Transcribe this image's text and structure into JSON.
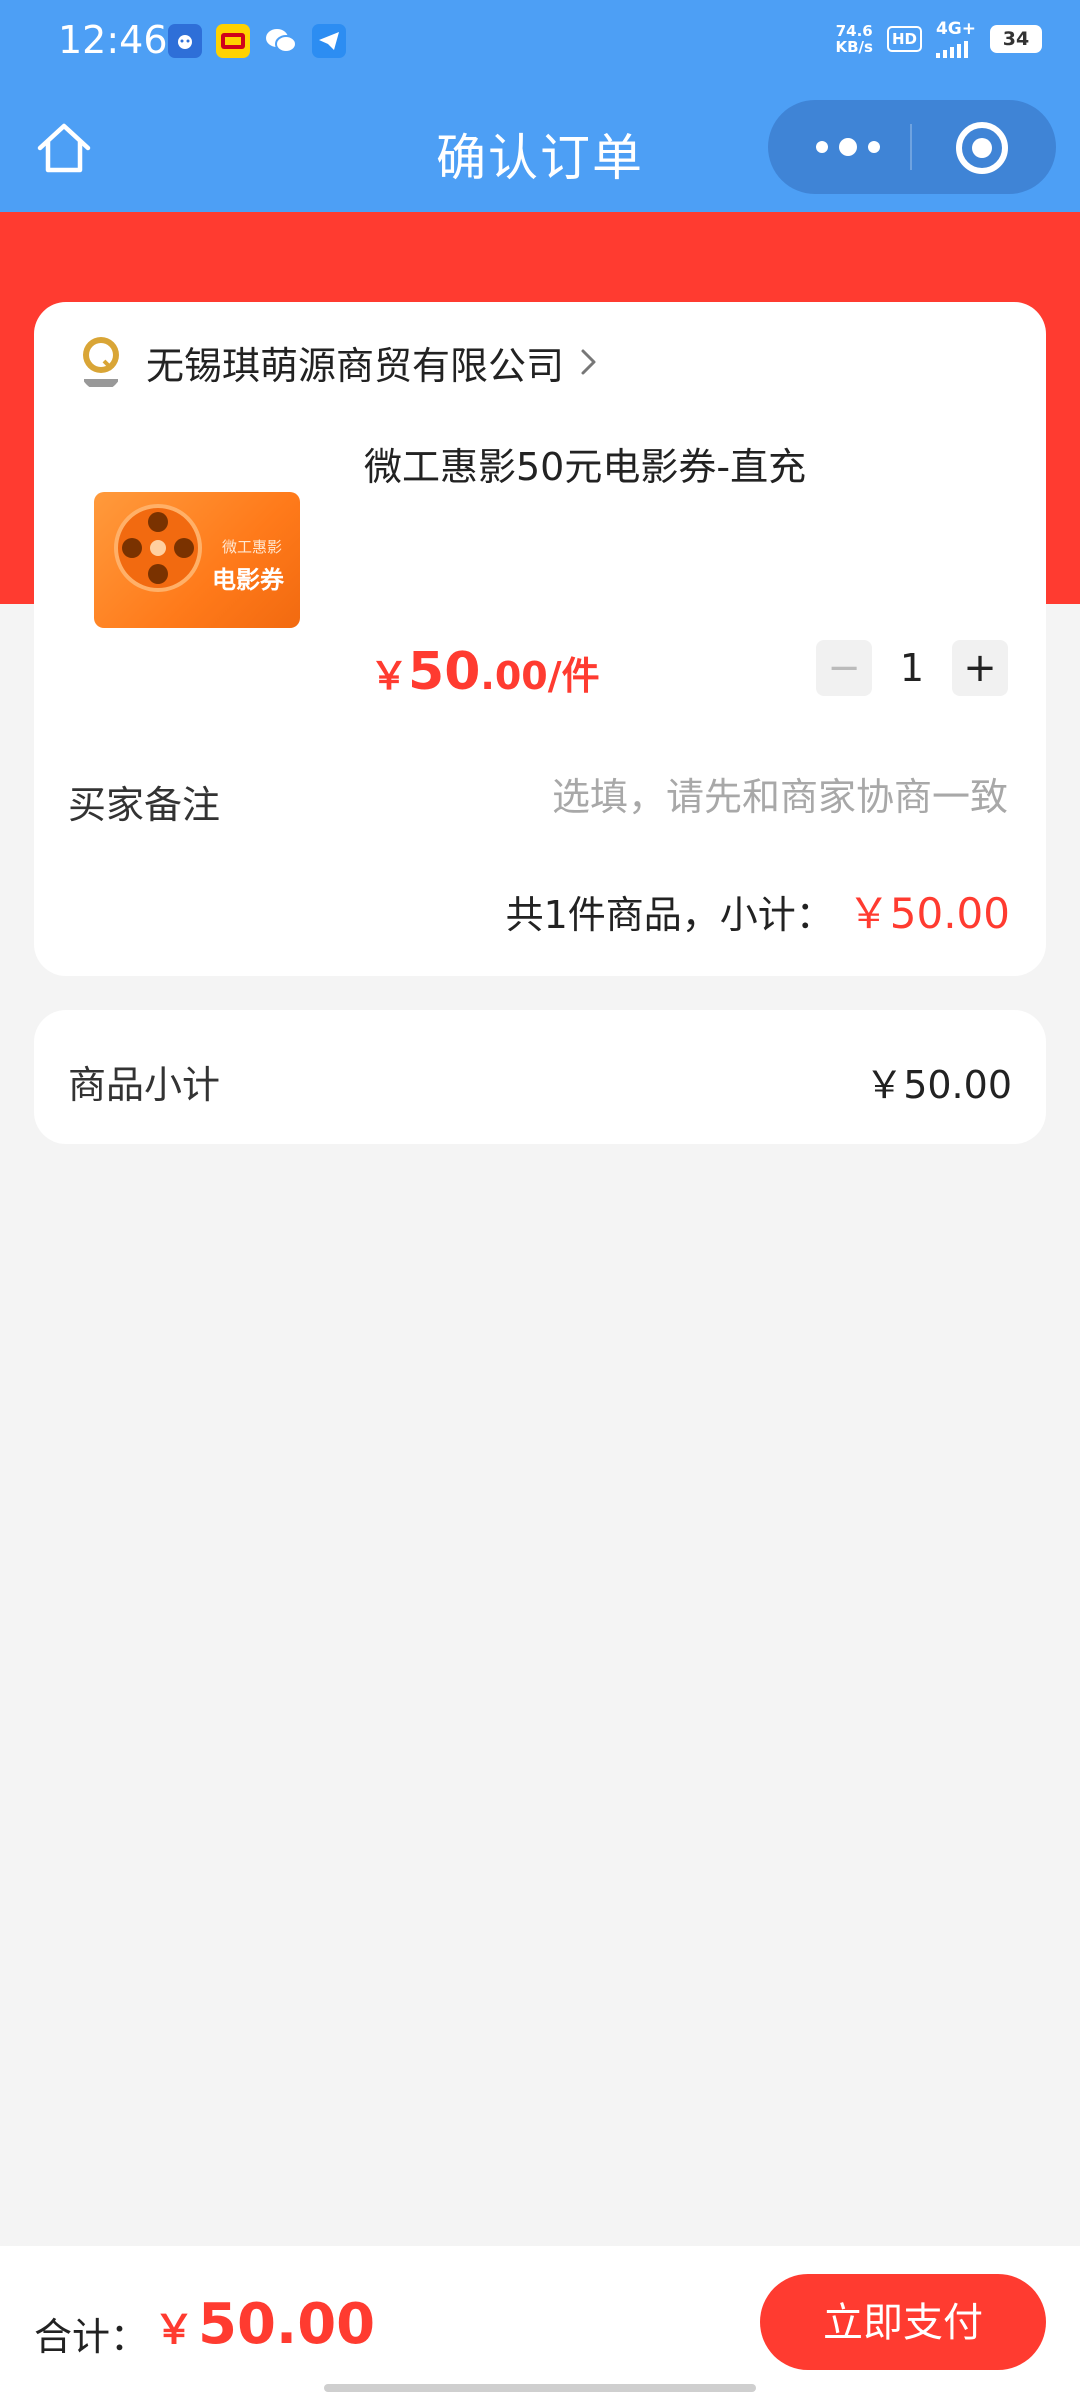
{
  "status_bar": {
    "time": "12:46",
    "net_speed_value": "74.6",
    "net_speed_unit": "KB/s",
    "hd_label": "HD",
    "network": "4G+",
    "battery": "34",
    "app_icons": [
      "baidu-app-icon",
      "app-badge-icon",
      "wechat-icon",
      "telegram-icon"
    ]
  },
  "nav": {
    "title": "确认订单",
    "icons": [
      "home-icon",
      "more-icon",
      "target-icon"
    ]
  },
  "shop": {
    "name": "无锡琪萌源商贸有限公司"
  },
  "product": {
    "title": "微工惠影50元电影券-直充",
    "image_subtitle": "微工惠影",
    "image_title": "电影券",
    "price_currency": "￥",
    "price_int": "50",
    "price_dec": ".00",
    "price_unit": "/件",
    "quantity": "1",
    "minus_label": "−",
    "plus_label": "+"
  },
  "remark": {
    "label": "买家备注",
    "placeholder": "选填，请先和商家协商一致",
    "value": ""
  },
  "subtotal": {
    "label": "共1件商品，小计：",
    "value": "￥50.00"
  },
  "summary": {
    "label": "商品小计",
    "value": "￥50.00"
  },
  "footer": {
    "total_label": "合计：",
    "total_currency": "￥",
    "total_value": "50.00",
    "pay_label": "立即支付"
  },
  "colors": {
    "primary_blue": "#4d9ff5",
    "accent_red": "#ff3b30",
    "background": "#f4f4f4"
  }
}
